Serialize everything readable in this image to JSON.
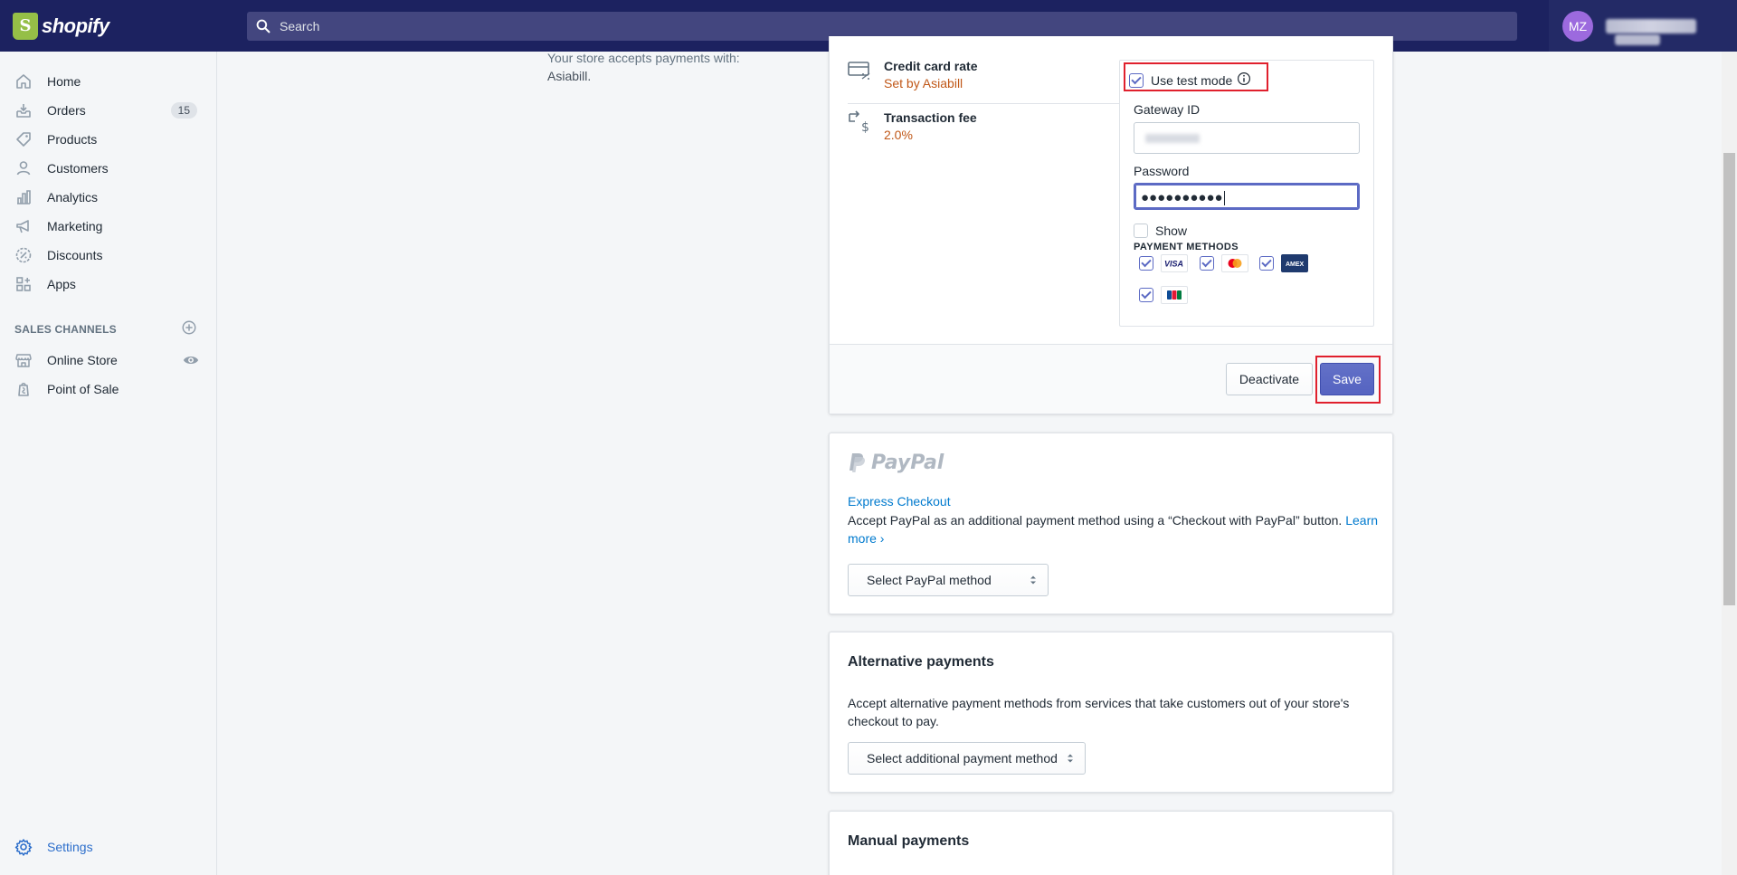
{
  "topbar": {
    "brand": "shopify",
    "search_placeholder": "Search",
    "user_initials": "MZ"
  },
  "sidebar": {
    "items": [
      {
        "label": "Home",
        "icon": "home-icon"
      },
      {
        "label": "Orders",
        "icon": "orders-icon",
        "badge": "15"
      },
      {
        "label": "Products",
        "icon": "tag-icon"
      },
      {
        "label": "Customers",
        "icon": "person-icon"
      },
      {
        "label": "Analytics",
        "icon": "bar-chart-icon"
      },
      {
        "label": "Marketing",
        "icon": "megaphone-icon"
      },
      {
        "label": "Discounts",
        "icon": "discount-icon"
      },
      {
        "label": "Apps",
        "icon": "apps-icon"
      }
    ],
    "sales_channels_title": "SALES CHANNELS",
    "channels": [
      {
        "label": "Online Store",
        "icon": "store-icon"
      },
      {
        "label": "Point of Sale",
        "icon": "pos-icon"
      }
    ],
    "settings_label": "Settings"
  },
  "main": {
    "left_desc_line1": "Your store accepts payments with:",
    "left_desc_line2": "Asiabill.",
    "gateway": {
      "credit_card_rate_title": "Credit card rate",
      "credit_card_rate_value": "Set by Asiabill",
      "transaction_fee_title": "Transaction fee",
      "transaction_fee_value": "2.0%",
      "use_test_mode_label": "Use test mode",
      "use_test_mode_checked": true,
      "gateway_id_label": "Gateway ID",
      "password_label": "Password",
      "password_value": "●●●●●●●●●●",
      "show_label": "Show",
      "payment_methods_title": "PAYMENT METHODS",
      "methods": [
        {
          "name": "Visa",
          "checked": true
        },
        {
          "name": "Mastercard",
          "checked": true
        },
        {
          "name": "American Express",
          "checked": true
        },
        {
          "name": "JCB",
          "checked": true
        }
      ],
      "deactivate_label": "Deactivate",
      "save_label": "Save"
    },
    "paypal": {
      "logo_text": "PayPal",
      "express_link": "Express Checkout",
      "description": "Accept PayPal as an additional payment method using a “Checkout with PayPal” button.",
      "learn_more": "Learn more ›",
      "select_label": "Select PayPal method"
    },
    "alternative": {
      "title": "Alternative payments",
      "description": "Accept alternative payment methods from services that take customers out of your store's checkout to pay.",
      "select_label": "Select additional payment method"
    },
    "manual": {
      "title": "Manual payments"
    }
  },
  "colors": {
    "topbar": "#1c2260",
    "primary_button": "#5c6ac4",
    "highlight": "#e0202d",
    "rate_value": "#c05717"
  }
}
